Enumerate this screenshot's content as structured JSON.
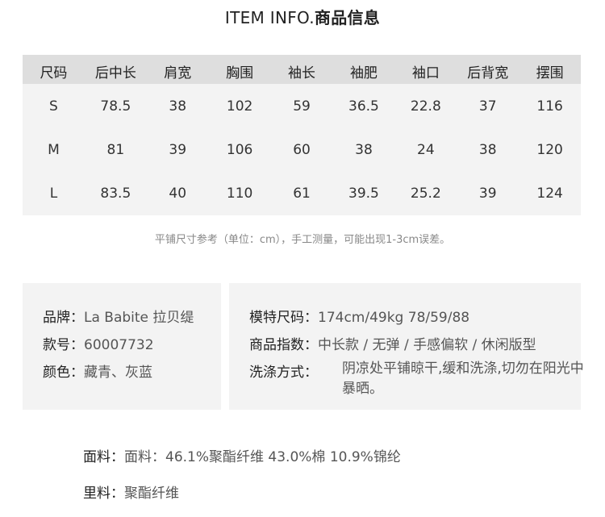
{
  "title": {
    "en": "ITEM INFO.",
    "cn": "商品信息"
  },
  "size_table": {
    "headers": [
      "尺码",
      "后中长",
      "肩宽",
      "胸围",
      "袖长",
      "袖肥",
      "袖口",
      "后背宽",
      "摆围"
    ],
    "rows": [
      [
        "S",
        "78.5",
        "38",
        "102",
        "59",
        "36.5",
        "22.8",
        "37",
        "116"
      ],
      [
        "M",
        "81",
        "39",
        "106",
        "60",
        "38",
        "24",
        "38",
        "120"
      ],
      [
        "L",
        "83.5",
        "40",
        "110",
        "61",
        "39.5",
        "25.2",
        "39",
        "124"
      ]
    ]
  },
  "note": "平铺尺寸参考（单位：cm），手工测量，可能出现1-3cm误差。",
  "left_info": [
    {
      "label": "品牌：",
      "value": "La Babite 拉贝缇"
    },
    {
      "label": "款号：",
      "value": "60007732"
    },
    {
      "label": "颜色：",
      "value": "藏青、灰蓝"
    }
  ],
  "right_info": [
    {
      "label": "模特尺码：",
      "value": "174cm/49kg 78/59/88"
    },
    {
      "label": "商品指数：",
      "value": "中长款 / 无弹 / 手感偏软 / 休闲版型"
    },
    {
      "label": "洗涤方式：",
      "value": "阴凉处平铺晾干,缓和洗涤,切勿在阳光中暴晒。"
    }
  ],
  "fabric": [
    {
      "label": "面料：",
      "value": "面料：46.1%聚酯纤维 43.0%棉 10.9%锦纶"
    },
    {
      "label": "里料：",
      "value": "聚酯纤维"
    }
  ]
}
